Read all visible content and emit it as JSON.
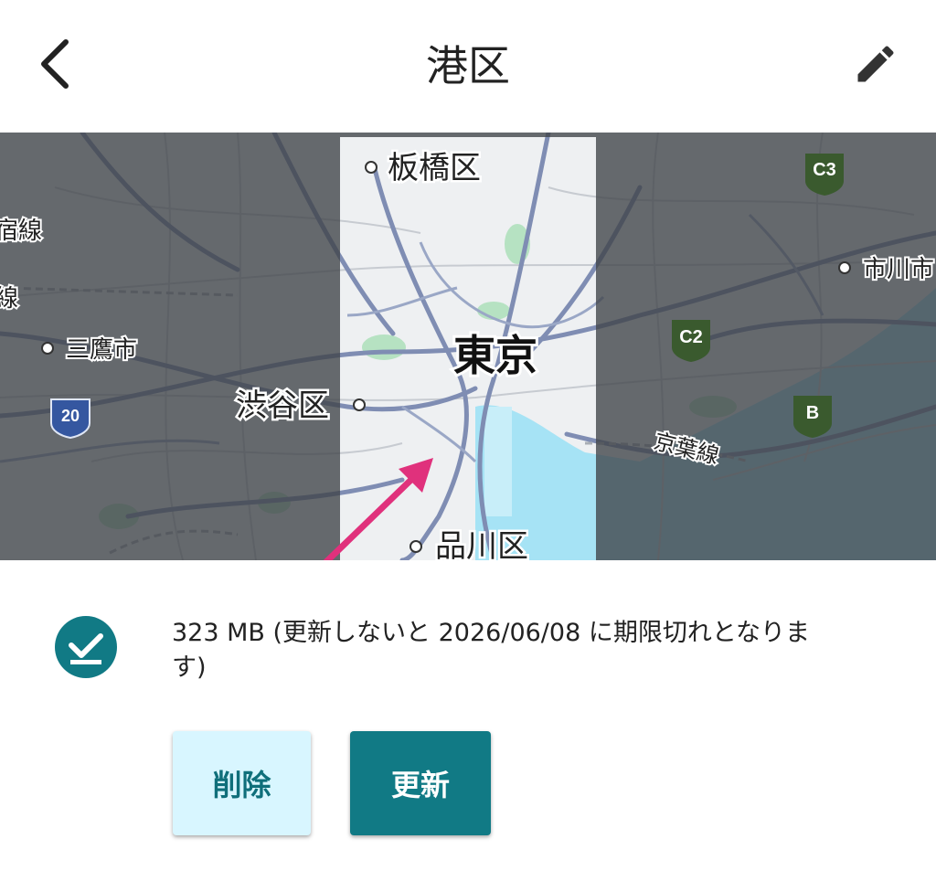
{
  "header": {
    "title": "港区",
    "back_icon": "chevron-left-icon",
    "edit_icon": "pencil-icon"
  },
  "map": {
    "labels": {
      "itabashi": "板橋区",
      "tokyo": "東京",
      "shibuya": "渋谷区",
      "shinagawa": "品川区",
      "mitaka": "三鷹市",
      "ichikawa": "市川市",
      "keiyo": "京葉線",
      "left_line_1": "宿線",
      "left_line_2": "線"
    },
    "shields": {
      "c3": "C3",
      "c2": "C2",
      "b": "B",
      "route20": "20"
    },
    "colors": {
      "dim_land": "#5a5e63",
      "bright_land": "#f6f7f8",
      "water": "#a6e3f5",
      "dim_water": "#3f6773",
      "highway": "#6b7ba6",
      "park": "#b6e2c2",
      "shield_green": "#3a5a2e",
      "arrow": "#e0317c"
    }
  },
  "download": {
    "status_icon": "download-check-icon",
    "size_text": "323 MB (更新しないと 2026/06/08 に期限切れとなります)"
  },
  "actions": {
    "delete_label": "削除",
    "update_label": "更新"
  },
  "theme": {
    "accent": "#117a85",
    "delete_bg": "#d8f6ff"
  }
}
